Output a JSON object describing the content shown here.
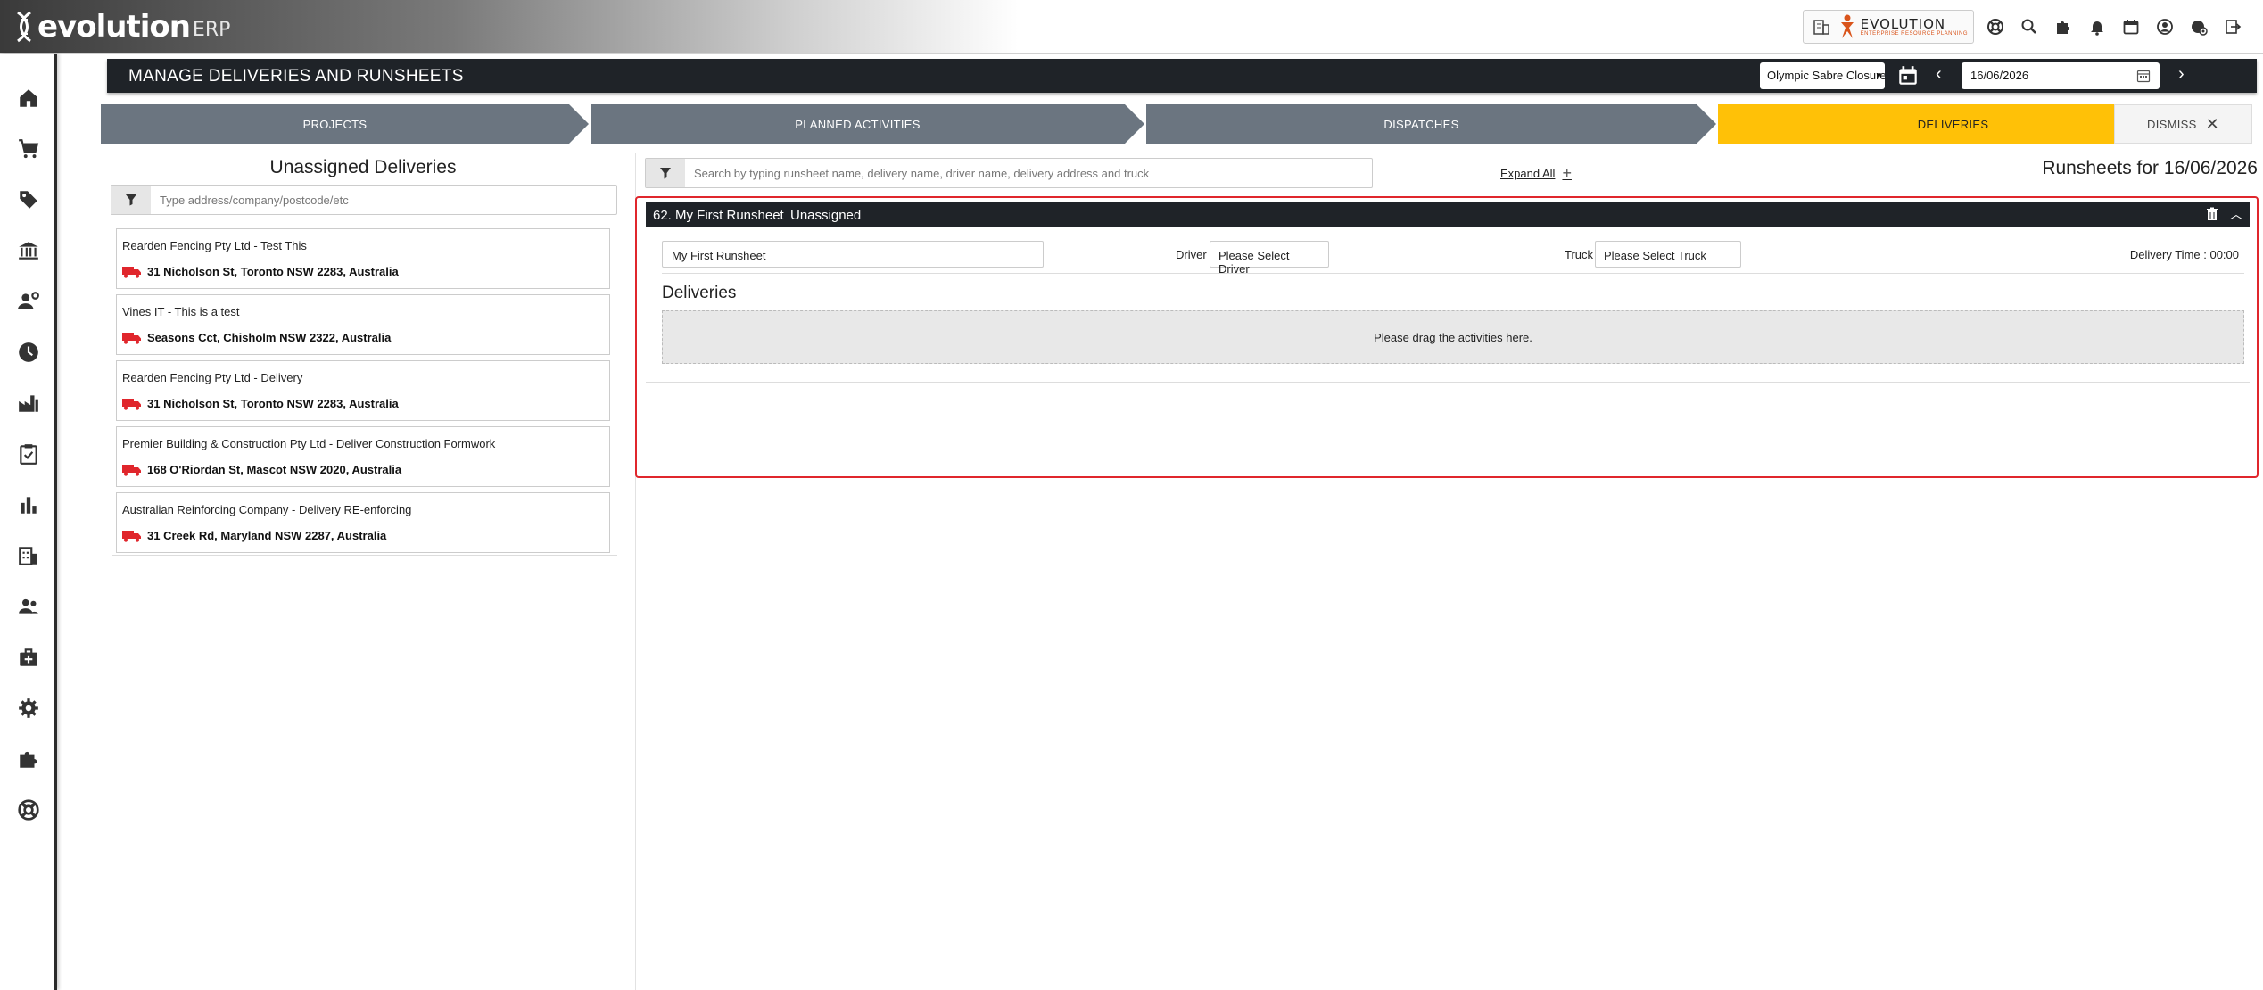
{
  "header": {
    "logo_text": "evolution",
    "logo_suffix": "ERP",
    "brand_name": "EVOLUTION",
    "brand_tagline": "ENTERPRISE RESOURCE PLANNING",
    "icons": [
      "building-icon",
      "help-lifebuoy-icon",
      "search-icon",
      "puzzle-icon",
      "bell-icon",
      "calendar-icon",
      "user-icon",
      "settings-badge-icon",
      "logout-icon"
    ]
  },
  "sidebar": {
    "items": [
      "home-icon",
      "cart-icon",
      "tag-icon",
      "bank-icon",
      "user-settings-icon",
      "clock-icon",
      "factory-icon",
      "clipboard-check-icon",
      "bar-chart-icon",
      "office-building-icon",
      "people-icon",
      "medical-kit-icon",
      "gear-icon",
      "puzzle-icon",
      "lifebuoy-icon"
    ]
  },
  "page": {
    "title": "MANAGE DELIVERIES AND RUNSHEETS",
    "company": "Olympic Sabre Closures",
    "date": "16/06/2026",
    "prev": "‹",
    "next": "›"
  },
  "stepper": {
    "steps": [
      {
        "label": "PROJECTS",
        "state": "done"
      },
      {
        "label": "PLANNED ACTIVITIES",
        "state": "done"
      },
      {
        "label": "DISPATCHES",
        "state": "done"
      },
      {
        "label": "DELIVERIES",
        "state": "active"
      },
      {
        "label": "DISMISS",
        "state": "dismiss"
      }
    ]
  },
  "unassigned": {
    "title": "Unassigned Deliveries",
    "filter_placeholder": "Type address/company/postcode/etc",
    "items": [
      {
        "name": "Rearden Fencing Pty Ltd - Test This",
        "address": "31 Nicholson St, Toronto NSW 2283, Australia"
      },
      {
        "name": "Vines IT - This is a test",
        "address": "Seasons Cct, Chisholm NSW 2322, Australia"
      },
      {
        "name": "Rearden Fencing Pty Ltd - Delivery",
        "address": "31 Nicholson St, Toronto NSW 2283, Australia"
      },
      {
        "name": "Premier Building & Construction Pty Ltd - Deliver Construction Formwork",
        "address": "168 O'Riordan St, Mascot NSW 2020, Australia"
      },
      {
        "name": "Australian Reinforcing Company - Delivery RE-enforcing",
        "address": "31 Creek Rd, Maryland NSW 2287, Australia"
      }
    ]
  },
  "runsheets": {
    "search_placeholder": "Search by typing runsheet name, delivery name, driver name, delivery address and truck",
    "expand_all": "Expand All",
    "title": "Runsheets for 16/06/2026",
    "sheet": {
      "title": "62. My First Runsheet",
      "status": "Unassigned",
      "name_value": "My First Runsheet",
      "driver_label": "Driver",
      "driver_value": "Please Select Driver",
      "truck_label": "Truck",
      "truck_value": "Please Select Truck",
      "delivery_time": "Delivery Time : 00:00",
      "deliveries_title": "Deliveries",
      "dropzone_text": "Please drag the activities here."
    }
  },
  "colors": {
    "header_dark": "#1f2328",
    "step_grey": "#6b7580",
    "step_active": "#ffc107",
    "highlight_red": "#e0262c",
    "truck_red": "#e0262c"
  }
}
